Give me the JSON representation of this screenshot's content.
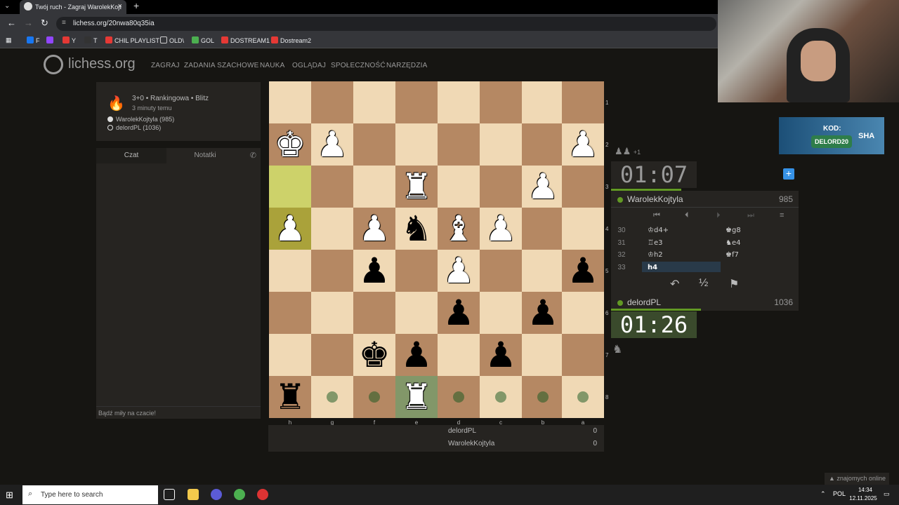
{
  "browser": {
    "tab_title": "Twój ruch - Zagraj WarolekKojt",
    "url": "lichess.org/20nwa80q35ia",
    "bookmarks": [
      "F",
      "Y",
      "T",
      "CHIL PLAYLIST",
      "OLD\\",
      "GOL",
      "DOSTREAM1",
      "Dostream2"
    ]
  },
  "site": {
    "logo": "lichess.org",
    "nav": [
      "ZAGRAJ",
      "ZADANIA SZACHOWE",
      "NAUKA",
      "OGLĄDAJ",
      "SPOŁECZNOŚĆ",
      "NARZĘDZIA"
    ]
  },
  "game_info": {
    "type": "3+0 • Rankingowa • Blitz",
    "time_ago": "3 minuty temu",
    "white": "WarolekKojtyla (985)",
    "black": "delordPL (1036)"
  },
  "chat": {
    "tab_chat": "Czat",
    "tab_notes": "Notatki",
    "placeholder": "Bądź miły na czacie!"
  },
  "board": {
    "ranks": [
      "1",
      "2",
      "3",
      "4",
      "5",
      "6",
      "7",
      "8"
    ],
    "files": [
      "h",
      "g",
      "f",
      "e",
      "d",
      "c",
      "b",
      "a"
    ],
    "last_move": [
      "h3",
      "h4"
    ],
    "selected": "e8",
    "move_dots": [
      "g8",
      "f8",
      "d8",
      "c8",
      "b8",
      "a8"
    ],
    "pieces": [
      {
        "sq": "h2",
        "piece": "K",
        "color": "w"
      },
      {
        "sq": "g2",
        "piece": "P",
        "color": "w"
      },
      {
        "sq": "a2",
        "piece": "P",
        "color": "w"
      },
      {
        "sq": "e3",
        "piece": "R",
        "color": "w"
      },
      {
        "sq": "b3",
        "piece": "P",
        "color": "w"
      },
      {
        "sq": "h4",
        "piece": "P",
        "color": "w"
      },
      {
        "sq": "f4",
        "piece": "P",
        "color": "w"
      },
      {
        "sq": "e4",
        "piece": "N",
        "color": "b"
      },
      {
        "sq": "d4",
        "piece": "B",
        "color": "w"
      },
      {
        "sq": "c4",
        "piece": "P",
        "color": "w"
      },
      {
        "sq": "f5",
        "piece": "P",
        "color": "b"
      },
      {
        "sq": "d5",
        "piece": "P",
        "color": "w"
      },
      {
        "sq": "a5",
        "piece": "P",
        "color": "b"
      },
      {
        "sq": "d6",
        "piece": "P",
        "color": "b"
      },
      {
        "sq": "b6",
        "piece": "P",
        "color": "b"
      },
      {
        "sq": "f7",
        "piece": "K",
        "color": "b"
      },
      {
        "sq": "e7",
        "piece": "P",
        "color": "b"
      },
      {
        "sq": "c7",
        "piece": "P",
        "color": "b"
      },
      {
        "sq": "h8",
        "piece": "R",
        "color": "b"
      },
      {
        "sq": "e8",
        "piece": "R",
        "color": "w"
      }
    ]
  },
  "material": {
    "rows": [
      {
        "name": "delordPL",
        "score": "0"
      },
      {
        "name": "WarolekKojtyla",
        "score": "0"
      }
    ]
  },
  "clocks": {
    "top": "01:07",
    "bottom": "01:26",
    "top_extra": "+1"
  },
  "players": {
    "top": {
      "name": "WarolekKojtyla",
      "rating": "985"
    },
    "bottom": {
      "name": "delordPL",
      "rating": "1036"
    }
  },
  "moves": [
    {
      "num": "30",
      "white": "♔d4+",
      "black": "♚g8"
    },
    {
      "num": "31",
      "white": "♖e3",
      "black": "♞e4"
    },
    {
      "num": "32",
      "white": "♔h2",
      "black": "♚f7"
    },
    {
      "num": "33",
      "white": "h4",
      "black": ""
    }
  ],
  "actions": {
    "takeback": "↶",
    "draw": "½",
    "resign": "⚑"
  },
  "overlay": {
    "promo_kod": "KOD:",
    "promo_code": "DELORD20",
    "promo_brand": "SHA",
    "online": "znajomych online"
  },
  "taskbar": {
    "search": "Type here to search",
    "lang": "POL",
    "time": "14:34",
    "date": "12.11.2025"
  },
  "colors": {
    "board_light": "#f0d9b5",
    "board_dark": "#b58863",
    "accent_green": "#629924",
    "bg": "#161512"
  }
}
